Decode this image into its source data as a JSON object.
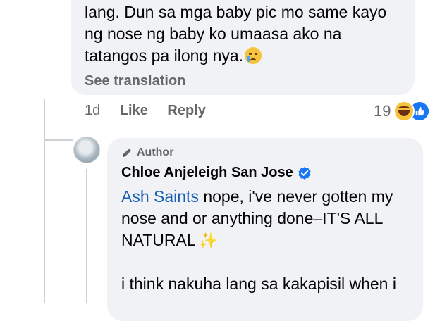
{
  "comment": {
    "lines": [
      "lang. Dun sa mga baby pic mo same kayo",
      "ng nose ng baby ko  umaasa ako na",
      "tatangos pa ilong nya."
    ],
    "emoji": "crying-face",
    "see_translation": "See translation",
    "time": "1d",
    "like_label": "Like",
    "reply_label": "Reply",
    "reaction_count": "19",
    "reaction_icons": [
      "haha-reaction-icon",
      "like-reaction-icon"
    ]
  },
  "reply": {
    "badge": "Author",
    "badge_icon": "pencil-icon",
    "name": "Chloe Anjeleigh San Jose",
    "verified_icon": "verified-badge-icon",
    "mention": "Ash Saints",
    "line1_rest": " nope, i've never gotten my",
    "line2": "nose and or anything done–IT'S ALL",
    "line3": "NATURAL",
    "sparkles": "✨",
    "line5": "i think nakuha lang sa kakapisil when i"
  },
  "colors": {
    "bubble": "#f0f2f5",
    "mention": "#1a5fb4",
    "meta": "#65676b",
    "like_blue": "#1877f2"
  }
}
